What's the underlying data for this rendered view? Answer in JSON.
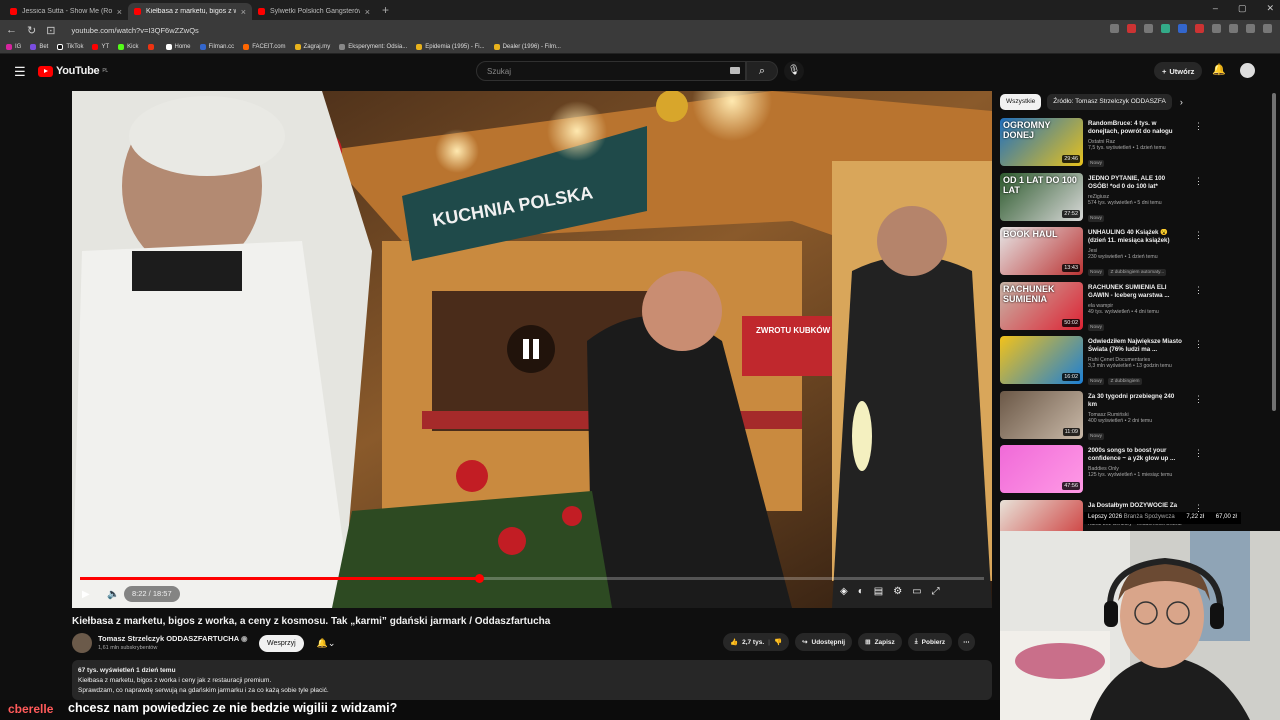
{
  "browser": {
    "tabs": [
      {
        "title": "Jessica Sutta - Show Me (Roma...",
        "active": false
      },
      {
        "title": "Kiełbasa z marketu, bigos z w...",
        "active": true
      },
      {
        "title": "Sylwetki Polskich Gangsterów #48: B...",
        "active": false
      }
    ],
    "url": "youtube.com/watch?v=I3QF6wZZwQs",
    "bookmarks": [
      "IG",
      "Bet",
      "TikTok",
      "YT",
      "Kick",
      "",
      "Home",
      "Filman.cc",
      "FACEIT.com",
      "Zagraj.my",
      "Eksperyment: Odsia...",
      "Epidemia (1995) - Fi...",
      "Dealer (1996) - Film..."
    ]
  },
  "youtube": {
    "logo_text": "YouTube",
    "logo_region": "PL",
    "search_placeholder": "Szukaj",
    "create_label": "Utwórz"
  },
  "player": {
    "time": "8:22 / 18:57",
    "progress": 0.4418,
    "scene_sign": "KUCHNIA POLSKA",
    "scene_sign2": "ZWROTU KUBKÓW"
  },
  "video": {
    "title": "Kiełbasa z marketu, bigos z worka, a ceny z kosmosu. Tak „karmi” gdański jarmark / Oddaszfartucha",
    "channel": "Tomasz Strzelczyk ODDASZFARTUCHA",
    "subscribers": "1,61 mln subskrybentów",
    "support_label": "Wesprzyj",
    "likes": "2,7 tys.",
    "share_label": "Udostępnij",
    "save_label": "Zapisz",
    "download_label": "Pobierz",
    "desc_stats": "67 tys. wyświetleń  1 dzień temu",
    "desc_line1": "Kiełbasa z marketu, bigos z worka i ceny jak z restauracji premium.",
    "desc_line2": "Sprawdzam, co naprawdę serwują na gdańskim jarmarku i za co każą sobie tyle płacić."
  },
  "sidebar": {
    "chips": [
      {
        "label": "Wszystkie",
        "active": true
      },
      {
        "label": "Źródło: Tomasz Strzelczyk ODDASZFA",
        "active": false
      }
    ],
    "recs": [
      {
        "title": "RandomBruce: 4 tys. w donejtach, powrót do nałogu",
        "channel": "Ostatni Raz",
        "meta": "7,5 tys. wyświetleń • 1 dzień temu",
        "badge": "Nowy",
        "badge2": "",
        "duration": "29:46",
        "thumb_text": "OGROMNY DONEJ",
        "color1": "#1f6fbf",
        "color2": "#e8c21c"
      },
      {
        "title": "JEDNO PYTANIE, ALE 100 OSÓB! *od 0 do 100 lat*",
        "channel": "reZigiusz",
        "meta": "574 tys. wyświetleń • 5 dni temu",
        "badge": "Nowy",
        "badge2": "",
        "duration": "27:52",
        "thumb_text": "OD 1 LAT DO 100 LAT",
        "color1": "#2d5a2d",
        "color2": "#d9d9d9"
      },
      {
        "title": "UNHAULING 40 Książek 😮 (dzień 11. miesiąca książek)",
        "channel": "Jesi",
        "meta": "230 wyświetleń • 1 dzień temu",
        "badge": "Nowy",
        "badge2": "Z dubbingiem automaty...",
        "duration": "13:43",
        "thumb_text": "BOOK HAUL",
        "color1": "#e6e6e6",
        "color2": "#b33"
      },
      {
        "title": "RACHUNEK SUMIENIA ELI GAWIN - Iceberg warstwa ...",
        "channel": "ela wampir",
        "meta": "49 tys. wyświetleń • 4 dni temu",
        "badge": "Nowy",
        "badge2": "",
        "duration": "50:02",
        "thumb_text": "RACHUNEK SUMIENIA",
        "color1": "#c8b6a8",
        "color2": "#d23"
      },
      {
        "title": "Odwiedziłem Największe Miasto Świata (76% ludzi ma ...",
        "channel": "Ruhi Çenet Documentaries",
        "meta": "3,3 mln wyświetleń • 13 godzin temu",
        "badge": "Nowy",
        "badge2": "Z dubbingiem",
        "duration": "16:02",
        "thumb_text": "",
        "color1": "#f3c21a",
        "color2": "#1b7fd6"
      },
      {
        "title": "Za 30 tygodni przebiegnę 240 km",
        "channel": "Tomasz Rumiński",
        "meta": "400 wyświetleń • 2 dni temu",
        "badge": "Nowy",
        "badge2": "",
        "duration": "11:09",
        "thumb_text": "",
        "color1": "#6b5847",
        "color2": "#c9b9a8"
      },
      {
        "title": "2000s songs to boost your confidence ~ a y2k glow up ...",
        "channel": "Baddies Only",
        "meta": "125 tys. wyświetleń • 1 miesiąc temu",
        "badge": "",
        "badge2": "",
        "duration": "47:56",
        "thumb_text": "",
        "color1": "#f06ad8",
        "color2": "#ff9ae6"
      },
      {
        "title": "Ja Dostałbym DOŻYWOCIE Za ...",
        "channel": "Kanał bez Cenzury • Wiadomości Dobrany",
        "meta": "",
        "badge": "",
        "badge2": "",
        "duration": "",
        "thumb_text": "",
        "color1": "#e8e2d8",
        "color2": "#c33"
      }
    ]
  },
  "ticker": {
    "label": "Lepszy 2026",
    "brand": "Branża Spożywcza",
    "price1": "7,22 zł",
    "price2": "67,00 zł"
  },
  "chat": {
    "user": "cberelle",
    "message": "chcesz nam powiedziec ze nie bedzie wigilii z widzami?"
  }
}
